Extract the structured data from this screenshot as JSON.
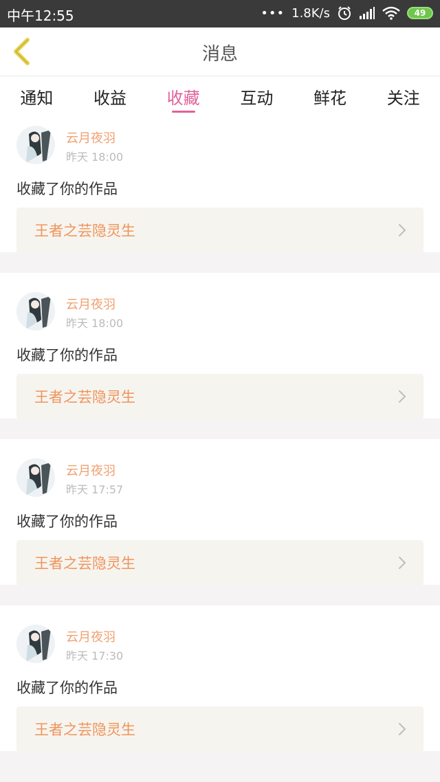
{
  "status_bar": {
    "time": "中午12:55",
    "dots": "•••",
    "net_speed": "1.8K/s",
    "battery": "49"
  },
  "header": {
    "title": "消息"
  },
  "tabs": [
    {
      "label": "通知"
    },
    {
      "label": "收益"
    },
    {
      "label": "收藏"
    },
    {
      "label": "互动"
    },
    {
      "label": "鲜花"
    },
    {
      "label": "关注"
    }
  ],
  "active_tab": "收藏",
  "messages": [
    {
      "user": "云月夜羽",
      "time": "昨天 18:00",
      "action": "收藏了你的作品",
      "work": "王者之芸隐灵生"
    },
    {
      "user": "云月夜羽",
      "time": "昨天 18:00",
      "action": "收藏了你的作品",
      "work": "王者之芸隐灵生"
    },
    {
      "user": "云月夜羽",
      "time": "昨天 17:57",
      "action": "收藏了你的作品",
      "work": "王者之芸隐灵生"
    },
    {
      "user": "云月夜羽",
      "time": "昨天 17:30",
      "action": "收藏了你的作品",
      "work": "王者之芸隐灵生"
    }
  ],
  "colors": {
    "accent": "#e0629a",
    "name": "#f0a070",
    "work": "#f0935a",
    "back_arrow": "#e8d24a"
  },
  "icons": {
    "back": "chevron-left-icon",
    "more": "chevron-right-icon",
    "wifi": "wifi-icon",
    "signal": "signal-icon",
    "alarm": "alarm-icon",
    "battery": "battery-icon"
  }
}
